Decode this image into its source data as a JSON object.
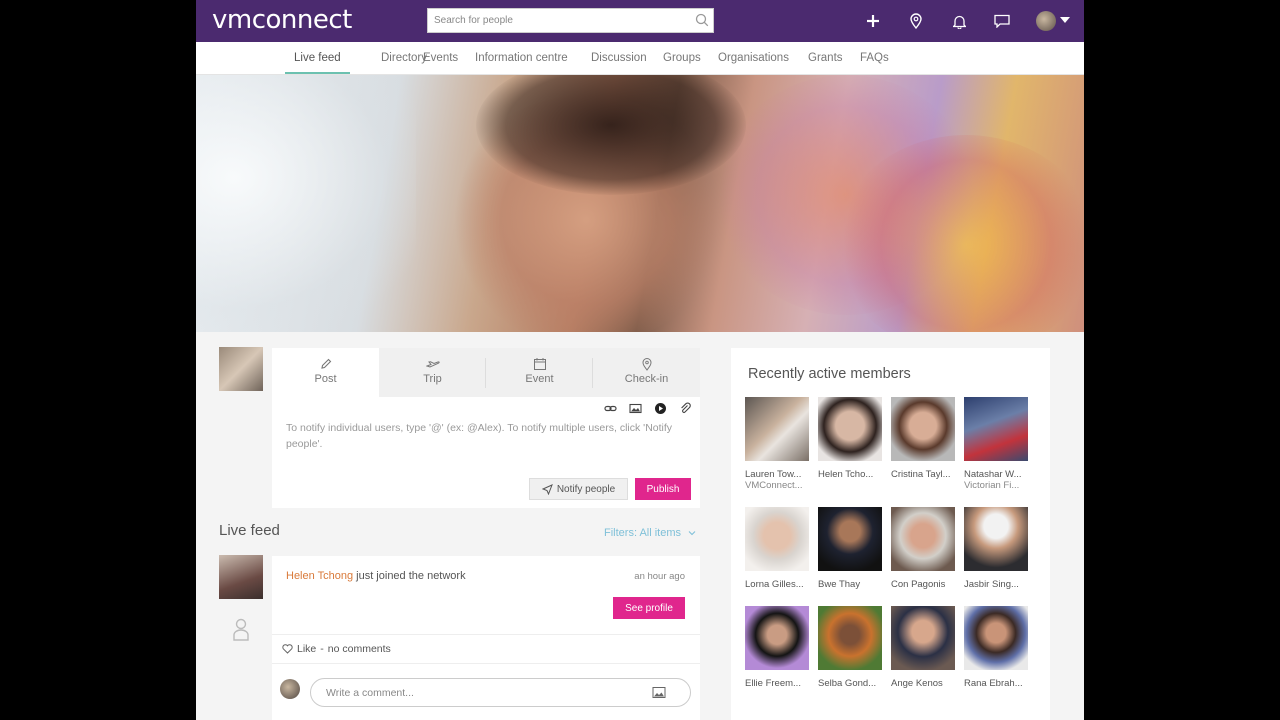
{
  "header": {
    "logo": "vmconnect",
    "search_placeholder": "Search for people",
    "icons": [
      "plus-icon",
      "location-pin-icon",
      "bell-icon",
      "chat-icon",
      "user-avatar",
      "caret-down-icon"
    ]
  },
  "nav": {
    "items": [
      {
        "label": "Live feed",
        "active": true
      },
      {
        "label": "Directory"
      },
      {
        "label": "Events"
      },
      {
        "label": "Information centre"
      },
      {
        "label": "Discussion"
      },
      {
        "label": "Groups"
      },
      {
        "label": "Organisations"
      },
      {
        "label": "Grants"
      },
      {
        "label": "FAQs"
      }
    ]
  },
  "composer": {
    "tabs": [
      {
        "label": "Post",
        "icon": "pencil-icon",
        "active": true
      },
      {
        "label": "Trip",
        "icon": "plane-icon"
      },
      {
        "label": "Event",
        "icon": "calendar-icon"
      },
      {
        "label": "Check-in",
        "icon": "location-pin-icon"
      }
    ],
    "tools": [
      "link-icon",
      "image-icon",
      "video-icon",
      "attachment-icon"
    ],
    "placeholder": "To notify individual users, type '@' (ex: @Alex). To notify multiple users, click 'Notify people'.",
    "notify_label": "Notify people",
    "publish_label": "Publish"
  },
  "feed": {
    "title": "Live feed",
    "filters_label": "Filters: All items",
    "item": {
      "user": "Helen Tchong",
      "action": " just joined the network",
      "time": "an hour ago",
      "button": "See profile",
      "like_label": "Like",
      "separator": "-",
      "comments_label": "no comments",
      "comment_placeholder": "Write a comment..."
    }
  },
  "members": {
    "title": "Recently active members",
    "list": [
      {
        "name": "Lauren Tow...",
        "org": "VMConnect..."
      },
      {
        "name": "Helen Tcho...",
        "org": ""
      },
      {
        "name": "Cristina Tayl...",
        "org": ""
      },
      {
        "name": "Natashar W...",
        "org": "Victorian Fi..."
      },
      {
        "name": "Lorna Gilles...",
        "org": ""
      },
      {
        "name": "Bwe Thay",
        "org": ""
      },
      {
        "name": "Con Pagonis",
        "org": ""
      },
      {
        "name": "Jasbir Sing...",
        "org": ""
      },
      {
        "name": "Ellie Freem...",
        "org": ""
      },
      {
        "name": "Selba Gond...",
        "org": ""
      },
      {
        "name": "Ange Kenos",
        "org": ""
      },
      {
        "name": "Rana Ebrah...",
        "org": ""
      }
    ]
  },
  "colors": {
    "header_bg": "#4b2a6f",
    "accent_pink": "#e0268d",
    "active_tab_underline": "#6cc1b0",
    "username_orange": "#d97a3a",
    "filter_blue": "#7fc0d8"
  }
}
